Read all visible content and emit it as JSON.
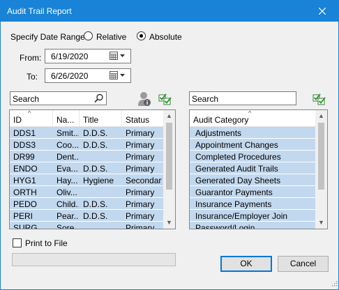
{
  "window": {
    "title": "Audit Trail Report"
  },
  "date_range": {
    "label": "Specify Date Range",
    "options": [
      {
        "label": "Relative",
        "selected": false
      },
      {
        "label": "Absolute",
        "selected": true
      }
    ],
    "from_label": "From:",
    "from_value": "6/19/2020",
    "to_label": "To:",
    "to_value": "6/26/2020"
  },
  "providers": {
    "search_placeholder": "Search",
    "columns": [
      "ID",
      "Na...",
      "Title",
      "Status"
    ],
    "rows": [
      [
        "DDS1",
        "Smit...",
        "D.D.S.",
        "Primary"
      ],
      [
        "DDS3",
        "Coo...",
        "D.D.S.",
        "Primary"
      ],
      [
        "DR99",
        "Dent...",
        "",
        "Primary"
      ],
      [
        "ENDO",
        "Eva...",
        "D.D.S.",
        "Primary"
      ],
      [
        "HYG1",
        "Hay...",
        "Hygiene",
        "Secondary"
      ],
      [
        "ORTH",
        "Oliv...",
        "",
        "Primary"
      ],
      [
        "PEDO",
        "Child...",
        "D.D.S.",
        "Primary"
      ],
      [
        "PERI",
        "Pear...",
        "D.D.S.",
        "Primary"
      ],
      [
        "SURG",
        "Sore...",
        "",
        "Primary"
      ]
    ]
  },
  "categories": {
    "search_placeholder": "Search",
    "column": "Audit Category",
    "rows": [
      "Adjustments",
      "Appointment Changes",
      "Completed Procedures",
      "Generated Audit Trails",
      "Generated Day Sheets",
      "Guarantor Payments",
      "Insurance Payments",
      "Insurance/Employer Join",
      "Password/Login"
    ]
  },
  "print_to_file": {
    "label": "Print to File",
    "checked": false
  },
  "buttons": {
    "ok": "OK",
    "cancel": "Cancel"
  },
  "colors": {
    "titlebar": "#1883d7",
    "selection": "#c2d8ee"
  }
}
